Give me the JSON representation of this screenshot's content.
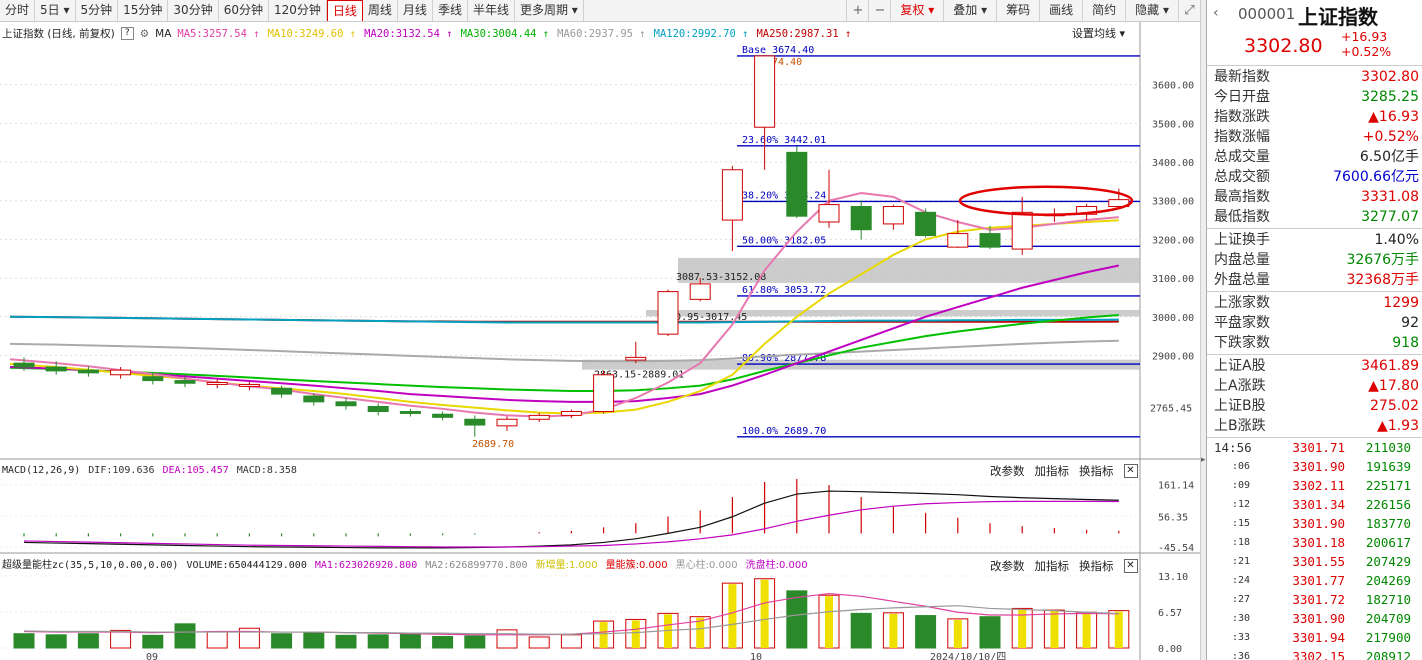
{
  "toolbar": {
    "periods": [
      "分时",
      "5日",
      "5分钟",
      "15分钟",
      "30分钟",
      "60分钟",
      "120分钟",
      "日线",
      "周线",
      "月线",
      "季线",
      "半年线",
      "更多周期"
    ],
    "active_period": "日线",
    "buttons": [
      "复权",
      "叠加",
      "筹码",
      "画线",
      "简约",
      "隐藏"
    ]
  },
  "ma_row": {
    "title": "上证指数 (日线, 前复权)",
    "ma_label": "MA",
    "items": [
      {
        "text": "MA5:3257.54",
        "color": "#e040a0"
      },
      {
        "text": "MA10:3249.60",
        "color": "#e0c000"
      },
      {
        "text": "MA20:3132.54",
        "color": "#c000c0"
      },
      {
        "text": "MA30:3004.44",
        "color": "#00b000"
      },
      {
        "text": "MA60:2937.95",
        "color": "#999999"
      },
      {
        "text": "MA120:2992.70",
        "color": "#00a0c0"
      },
      {
        "text": "MA250:2987.31",
        "color": "#c00000"
      }
    ],
    "settings": "设置均线"
  },
  "price_axis": [
    "3600.00",
    "3500.00",
    "3400.00",
    "3300.00",
    "3200.00",
    "3100.00",
    "3000.00",
    "2900.00",
    "2765.45"
  ],
  "fib_labels": [
    {
      "text": "Base   3674.40",
      "color": "#0000c0"
    },
    {
      "text": "3674.40",
      "color": "#c05000"
    },
    {
      "text": "23.60%  3442.01",
      "color": "#0000c0"
    },
    {
      "text": "38.20%  3298.24",
      "color": "#0000c0"
    },
    {
      "text": "50.00%  3182.05",
      "color": "#0000c0"
    },
    {
      "text": "61.80%  3053.72",
      "color": "#0000c0"
    },
    {
      "text": "80.90%  2877.78",
      "color": "#0000c0"
    },
    {
      "text": "100.0%  2689.70",
      "color": "#0000c0"
    }
  ],
  "gap_labels": [
    "3087.53-3152.08",
    "3000.95-3017.45",
    "2863.15-2889.01",
    "2689.70"
  ],
  "macd": {
    "title": "MACD(12,26,9)",
    "dif": "DIF:109.636",
    "dea": "DEA:105.457",
    "macd": "MACD:8.358",
    "axis": [
      "161.14",
      "56.35",
      "-45.54"
    ]
  },
  "volume": {
    "title": "超级量能柱zc(35,5,10,0.00,0.00)",
    "vol": "VOLUME:650444129.000",
    "ma1": "MA1:623026920.800",
    "ma2": "MA2:626899770.800",
    "xinzeng": "新增量:1.000",
    "liangneng": "量能簇:0.000",
    "heixin": "黑心柱:0.000",
    "xipan": "洗盘柱:0.000",
    "axis": [
      "13.10",
      "6.57",
      "0.00"
    ]
  },
  "panel_buttons": [
    "改参数",
    "加指标",
    "换指标"
  ],
  "x_axis": [
    "09",
    "10",
    "2024/10/10/四"
  ],
  "quote": {
    "code": "000001",
    "name": "上证指数",
    "price": "3302.80",
    "change": "+16.93",
    "change_pct": "+0.52%",
    "group1": [
      {
        "k": "最新指数",
        "v": "3302.80",
        "c": "red"
      },
      {
        "k": "今日开盘",
        "v": "3285.25",
        "c": "green"
      },
      {
        "k": "指数涨跌",
        "v": "▲16.93",
        "c": "red"
      },
      {
        "k": "指数涨幅",
        "v": "+0.52%",
        "c": "red"
      },
      {
        "k": "总成交量",
        "v": "6.50亿手",
        "c": ""
      },
      {
        "k": "总成交额",
        "v": "7600.66亿元",
        "c": "blue"
      },
      {
        "k": "最高指数",
        "v": "3331.08",
        "c": "red"
      },
      {
        "k": "最低指数",
        "v": "3277.07",
        "c": "green"
      }
    ],
    "group2": [
      {
        "k": "上证换手",
        "v": "1.40%",
        "c": ""
      },
      {
        "k": "内盘总量",
        "v": "32676万手",
        "c": "green"
      },
      {
        "k": "外盘总量",
        "v": "32368万手",
        "c": "red"
      }
    ],
    "group3": [
      {
        "k": "上涨家数",
        "v": "1299",
        "c": "red"
      },
      {
        "k": "平盘家数",
        "v": "92",
        "c": ""
      },
      {
        "k": "下跌家数",
        "v": "918",
        "c": "green"
      }
    ],
    "group4": [
      {
        "k": "上证A股",
        "v": "3461.89",
        "c": "red"
      },
      {
        "k": "上A涨跌",
        "v": "▲17.80",
        "c": "red"
      },
      {
        "k": "上证B股",
        "v": "275.02",
        "c": "red"
      },
      {
        "k": "上B涨跌",
        "v": "▲1.93",
        "c": "red"
      }
    ],
    "ticks": [
      {
        "t": "14:56",
        "p": "3301.71",
        "v": "211030"
      },
      {
        "t": ":06",
        "p": "3301.90",
        "v": "191639"
      },
      {
        "t": ":09",
        "p": "3302.11",
        "v": "225171"
      },
      {
        "t": ":12",
        "p": "3301.34",
        "v": "226156"
      },
      {
        "t": ":15",
        "p": "3301.90",
        "v": "183770"
      },
      {
        "t": ":18",
        "p": "3301.18",
        "v": "200617"
      },
      {
        "t": ":21",
        "p": "3301.55",
        "v": "207429"
      },
      {
        "t": ":24",
        "p": "3301.77",
        "v": "204269"
      },
      {
        "t": ":27",
        "p": "3301.72",
        "v": "182710"
      },
      {
        "t": ":30",
        "p": "3301.90",
        "v": "204709"
      },
      {
        "t": ":33",
        "p": "3301.94",
        "v": "217900"
      },
      {
        "t": ":36",
        "p": "3302.15",
        "v": "208912"
      }
    ]
  },
  "chart_data": {
    "type": "candlestick",
    "ylim": [
      2640,
      3700
    ],
    "candles": [
      [
        2880,
        2870,
        2895,
        2860
      ],
      [
        2870,
        2860,
        2885,
        2850
      ],
      [
        2862,
        2855,
        2872,
        2845
      ],
      [
        2850,
        2862,
        2870,
        2840
      ],
      [
        2845,
        2835,
        2855,
        2825
      ],
      [
        2835,
        2828,
        2845,
        2818
      ],
      [
        2825,
        2830,
        2838,
        2815
      ],
      [
        2820,
        2825,
        2832,
        2810
      ],
      [
        2815,
        2800,
        2822,
        2790
      ],
      [
        2795,
        2780,
        2802,
        2770
      ],
      [
        2780,
        2770,
        2790,
        2760
      ],
      [
        2768,
        2755,
        2776,
        2745
      ],
      [
        2755,
        2750,
        2762,
        2742
      ],
      [
        2748,
        2740,
        2755,
        2732
      ],
      [
        2735,
        2720,
        2745,
        2689.7
      ],
      [
        2718,
        2735,
        2742,
        2705
      ],
      [
        2735,
        2745,
        2752,
        2728
      ],
      [
        2745,
        2755,
        2760,
        2738
      ],
      [
        2755,
        2850,
        2860,
        2750
      ],
      [
        2888,
        2895,
        2935,
        2880
      ],
      [
        2955,
        3065,
        3070,
        2950
      ],
      [
        3045,
        3085,
        3100,
        3040
      ],
      [
        3250,
        3380,
        3390,
        3170
      ],
      [
        3490,
        3674.4,
        3674.4,
        3380
      ],
      [
        3425,
        3260,
        3440,
        3255
      ],
      [
        3245,
        3290,
        3380,
        3230
      ],
      [
        3285,
        3225,
        3300,
        3200
      ],
      [
        3240,
        3285,
        3290,
        3225
      ],
      [
        3270,
        3210,
        3280,
        3205
      ],
      [
        3180,
        3215,
        3250,
        3178
      ],
      [
        3215,
        3180,
        3235,
        3175
      ],
      [
        3175,
        3270,
        3310,
        3160
      ],
      [
        3265,
        3265,
        3280,
        3245
      ],
      [
        3265,
        3285,
        3292,
        3250
      ],
      [
        3285,
        3302.8,
        3331.08,
        3277.07
      ]
    ],
    "ma5": [
      2890,
      2880,
      2872,
      2862,
      2852,
      2840,
      2830,
      2820,
      2812,
      2800,
      2790,
      2780,
      2770,
      2762,
      2752,
      2745,
      2742,
      2745,
      2760,
      2790,
      2830,
      2880,
      2980,
      3120,
      3220,
      3300,
      3320,
      3310,
      3270,
      3245,
      3225,
      3230,
      3240,
      3250,
      3257.54
    ],
    "ma10": [
      2878,
      2870,
      2863,
      2855,
      2847,
      2840,
      2830,
      2822,
      2815,
      2808,
      2800,
      2790,
      2780,
      2772,
      2765,
      2758,
      2752,
      2750,
      2752,
      2760,
      2780,
      2808,
      2850,
      2930,
      3000,
      3060,
      3110,
      3160,
      3200,
      3220,
      3230,
      3235,
      3240,
      3245,
      3249.6
    ],
    "ma20": [
      2870,
      2866,
      2862,
      2857,
      2852,
      2846,
      2840,
      2834,
      2828,
      2822,
      2815,
      2808,
      2800,
      2795,
      2790,
      2785,
      2782,
      2780,
      2780,
      2782,
      2790,
      2800,
      2822,
      2850,
      2880,
      2910,
      2940,
      2970,
      3000,
      3025,
      3050,
      3075,
      3095,
      3115,
      3132.54
    ],
    "ma30": [
      2868,
      2865,
      2862,
      2858,
      2855,
      2851,
      2847,
      2843,
      2838,
      2834,
      2830,
      2826,
      2822,
      2818,
      2815,
      2812,
      2810,
      2808,
      2808,
      2810,
      2815,
      2822,
      2838,
      2860,
      2880,
      2900,
      2920,
      2935,
      2950,
      2962,
      2972,
      2982,
      2990,
      2998,
      3004.44
    ],
    "ma60": [
      2930,
      2928,
      2926,
      2924,
      2922,
      2920,
      2917,
      2914,
      2911,
      2908,
      2905,
      2902,
      2899,
      2896,
      2893,
      2890,
      2888,
      2886,
      2885,
      2885,
      2886,
      2888,
      2892,
      2898,
      2902,
      2906,
      2910,
      2914,
      2918,
      2922,
      2926,
      2930,
      2933,
      2936,
      2937.95
    ],
    "ma120": [
      3000,
      2999,
      2998,
      2997,
      2996,
      2995,
      2994,
      2993,
      2992,
      2991,
      2990,
      2989,
      2988,
      2987,
      2986,
      2985,
      2985,
      2985,
      2985,
      2985,
      2985,
      2985,
      2986,
      2987,
      2988,
      2989,
      2990,
      2990,
      2990,
      2991,
      2991,
      2992,
      2992,
      2992,
      2992.7
    ],
    "ma250": [
      3000,
      2999,
      2998,
      2997,
      2996,
      2995,
      2994,
      2993,
      2992,
      2991,
      2990,
      2989,
      2988,
      2988,
      2987,
      2987,
      2987,
      2987,
      2987,
      2987,
      2987,
      2987,
      2987,
      2987,
      2987,
      2987,
      2987,
      2987,
      2987,
      2987,
      2987,
      2987,
      2987,
      2987,
      2987.31
    ],
    "fib_levels": [
      3674.4,
      3442.01,
      3298.24,
      3182.05,
      3053.72,
      2877.78,
      2689.7
    ],
    "gap_zones": [
      [
        3087.53,
        3152.08
      ],
      [
        3000.95,
        3017.45
      ],
      [
        2863.15,
        2889.01
      ]
    ],
    "macd_lim": [
      -55,
      170
    ],
    "dif": [
      -30,
      -32,
      -34,
      -36,
      -38,
      -40,
      -42,
      -44,
      -45,
      -46,
      -47,
      -48,
      -48,
      -48,
      -47,
      -45,
      -42,
      -38,
      -30,
      -18,
      0,
      20,
      55,
      100,
      130,
      140,
      138,
      135,
      132,
      128,
      122,
      118,
      115,
      112,
      109.636
    ],
    "dea": [
      -25,
      -27,
      -29,
      -31,
      -33,
      -35,
      -37,
      -39,
      -40,
      -41,
      -42,
      -43,
      -44,
      -45,
      -45,
      -45,
      -44,
      -42,
      -40,
      -35,
      -28,
      -18,
      -5,
      15,
      40,
      60,
      78,
      90,
      98,
      102,
      105,
      106,
      106,
      106,
      105.457
    ],
    "vol_lim": [
      0,
      13.1
    ],
    "volumes": [
      2.6,
      2.4,
      2.6,
      3.2,
      2.3,
      4.4,
      3.0,
      3.6,
      2.6,
      2.8,
      2.3,
      2.4,
      2.6,
      2.1,
      2.2,
      3.3,
      2.0,
      2.4,
      4.9,
      5.2,
      6.3,
      5.7,
      11.8,
      12.6,
      10.4,
      9.6,
      6.3,
      6.4,
      5.9,
      5.3,
      5.7,
      7.2,
      6.9,
      6.5,
      6.8
    ],
    "vol_ma1": [
      3.0,
      2.9,
      2.9,
      2.9,
      2.8,
      2.9,
      3.0,
      3.0,
      2.9,
      2.9,
      2.8,
      2.7,
      2.6,
      2.5,
      2.4,
      2.4,
      2.4,
      2.5,
      2.9,
      3.4,
      4.2,
      4.9,
      6.4,
      8.2,
      9.2,
      9.9,
      9.4,
      8.5,
      7.6,
      6.5,
      6.0,
      6.0,
      6.2,
      6.3,
      6.23
    ],
    "vol_ma2": [
      3.1,
      3.0,
      3.0,
      3.0,
      2.9,
      2.9,
      2.9,
      2.9,
      2.9,
      2.9,
      2.8,
      2.8,
      2.7,
      2.7,
      2.6,
      2.6,
      2.5,
      2.5,
      2.6,
      2.8,
      3.2,
      3.5,
      4.3,
      5.2,
      6.0,
      6.6,
      7.0,
      7.3,
      7.5,
      7.7,
      7.2,
      7.0,
      6.8,
      6.5,
      6.27
    ]
  }
}
